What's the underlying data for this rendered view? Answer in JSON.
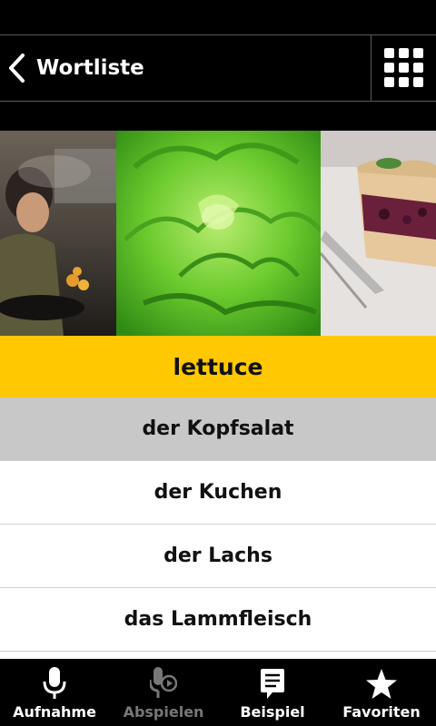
{
  "header": {
    "back_label": "Wortliste",
    "back_icon": "chevron-left-icon",
    "menu_icon": "grid-icon"
  },
  "gallery": [
    {
      "name": "cooking-photo",
      "desc": "woman cooking"
    },
    {
      "name": "lettuce-photo",
      "desc": "lettuce"
    },
    {
      "name": "cake-photo",
      "desc": "berry cake"
    }
  ],
  "list": {
    "term": "lettuce",
    "items": [
      "der Kopfsalat",
      "der Kuchen",
      "der Lachs",
      "das Lammfleisch"
    ],
    "selected_index": 0
  },
  "tabs": [
    {
      "label": "Aufnahme",
      "icon": "microphone-icon",
      "enabled": true
    },
    {
      "label": "Abspielen",
      "icon": "play-recording-icon",
      "enabled": false
    },
    {
      "label": "Beispiel",
      "icon": "speech-bubble-icon",
      "enabled": true
    },
    {
      "label": "Favoriten",
      "icon": "star-icon",
      "enabled": true
    }
  ],
  "colors": {
    "term_bg": "#ffc800",
    "selected_bg": "#c8c8c8",
    "bar_bg": "#000000",
    "text": "#111111",
    "disabled_text": "#777777"
  }
}
